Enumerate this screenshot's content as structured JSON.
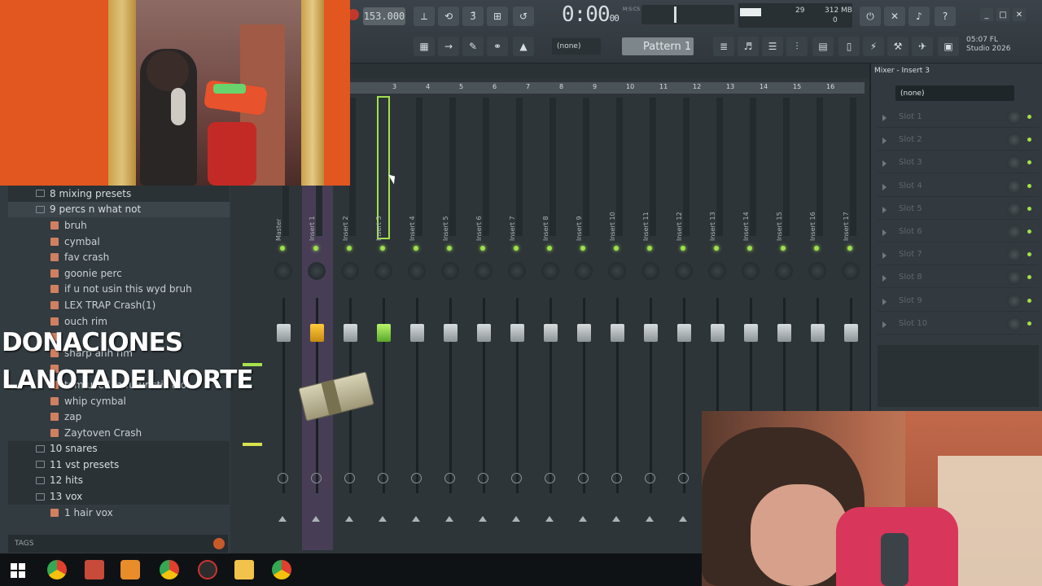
{
  "toolbar": {
    "tempo": "153.000",
    "time": "0:00",
    "time_sub": "00",
    "time_unit": "M:S:CS",
    "cpu_mem": "312 MB",
    "cpu_val1": "29",
    "cpu_val2": "0",
    "pattern_selector": "(none)",
    "pattern": "Pattern 1",
    "brand_line1": "05:07  FL",
    "brand_line2": "Studio 2026"
  },
  "browser": {
    "items": [
      {
        "type": "folder",
        "label": "8 mixing presets"
      },
      {
        "type": "folder-open",
        "label": "9 percs n what not"
      },
      {
        "type": "file",
        "label": "bruh"
      },
      {
        "type": "file",
        "label": "cymbal"
      },
      {
        "type": "file",
        "label": "fav crash"
      },
      {
        "type": "file",
        "label": "goonie perc"
      },
      {
        "type": "file",
        "label": "if u not usin this wyd bruh"
      },
      {
        "type": "file",
        "label": "LEX TRAP Crash(1)"
      },
      {
        "type": "file",
        "label": "ouch rim"
      },
      {
        "type": "file",
        "label": ""
      },
      {
        "type": "file",
        "label": "sharp ahh rim"
      },
      {
        "type": "file",
        "label": ""
      },
      {
        "type": "file",
        "label": "tom used in futuristic alot"
      },
      {
        "type": "file",
        "label": "whip cymbal"
      },
      {
        "type": "file",
        "label": "zap"
      },
      {
        "type": "file",
        "label": "Zaytoven Crash"
      },
      {
        "type": "folder",
        "label": "10 snares"
      },
      {
        "type": "folder",
        "label": "11 vst presets"
      },
      {
        "type": "folder",
        "label": "12 hits"
      },
      {
        "type": "folder",
        "label": "13 vox"
      },
      {
        "type": "file",
        "label": "1 hair vox"
      }
    ],
    "tags_label": "TAGS"
  },
  "overlay": {
    "donate_line1": "DONACIONES",
    "donate_line2": "LANOTADELNORTE"
  },
  "mixer": {
    "ruler": [
      "3",
      "4",
      "5",
      "6",
      "7",
      "8",
      "9",
      "10",
      "11",
      "12",
      "13",
      "14",
      "15",
      "16"
    ],
    "strips": [
      {
        "name": "Master",
        "state": "master"
      },
      {
        "name": "Insert 1",
        "state": "selected"
      },
      {
        "name": "Insert 2",
        "state": ""
      },
      {
        "name": "Insert 3",
        "state": "active"
      },
      {
        "name": "Insert 4",
        "state": ""
      },
      {
        "name": "Insert 5",
        "state": ""
      },
      {
        "name": "Insert 6",
        "state": ""
      },
      {
        "name": "Insert 7",
        "state": ""
      },
      {
        "name": "Insert 8",
        "state": ""
      },
      {
        "name": "Insert 9",
        "state": ""
      },
      {
        "name": "Insert 10",
        "state": ""
      },
      {
        "name": "Insert 11",
        "state": ""
      },
      {
        "name": "Insert 12",
        "state": ""
      },
      {
        "name": "Insert 13",
        "state": ""
      },
      {
        "name": "Insert 14",
        "state": ""
      },
      {
        "name": "Insert 15",
        "state": ""
      },
      {
        "name": "Insert 16",
        "state": ""
      },
      {
        "name": "Insert 17",
        "state": ""
      }
    ]
  },
  "insert_panel": {
    "title": "Mixer - Insert 3",
    "selector": "(none)",
    "slots": [
      "Slot 1",
      "Slot 2",
      "Slot 3",
      "Slot 4",
      "Slot 5",
      "Slot 6",
      "Slot 7",
      "Slot 8",
      "Slot 9",
      "Slot 10"
    ]
  },
  "taskbar": {
    "icons": [
      "windows-start-icon",
      "chrome-icon",
      "video-icon",
      "fl-studio-icon",
      "chrome-icon",
      "media-icon",
      "file-explorer-icon",
      "chrome-icon"
    ]
  },
  "colors": {
    "accent_green": "#a3e04c",
    "accent_yellow": "#f1b823",
    "panel": "#2d3539"
  }
}
